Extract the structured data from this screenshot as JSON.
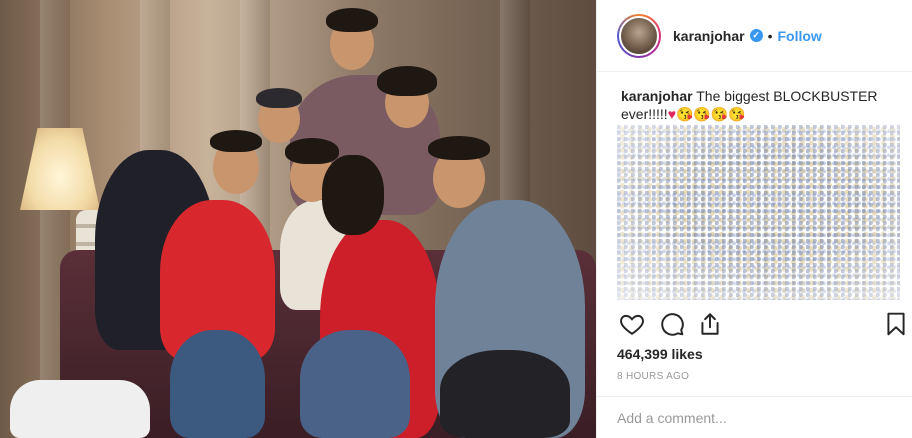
{
  "header": {
    "username": "karanjohar",
    "verified_glyph": "✓",
    "separator": "•",
    "follow_label": "Follow"
  },
  "caption": {
    "username": "karanjohar",
    "text": "The biggest BLOCKBUSTER ever!!!!!",
    "heart": "♥",
    "emojis": "😘😘😘😘"
  },
  "actions": {
    "like_icon": "heart-icon",
    "comment_icon": "comment-icon",
    "share_icon": "share-icon",
    "save_icon": "bookmark-icon"
  },
  "likes_text": "464,399 likes",
  "time_text": "8 HOURS AGO",
  "comment": {
    "placeholder": "Add a comment..."
  },
  "colors": {
    "accent": "#3897f0",
    "text": "#262626",
    "muted": "#999999",
    "heart": "#e0245e"
  }
}
